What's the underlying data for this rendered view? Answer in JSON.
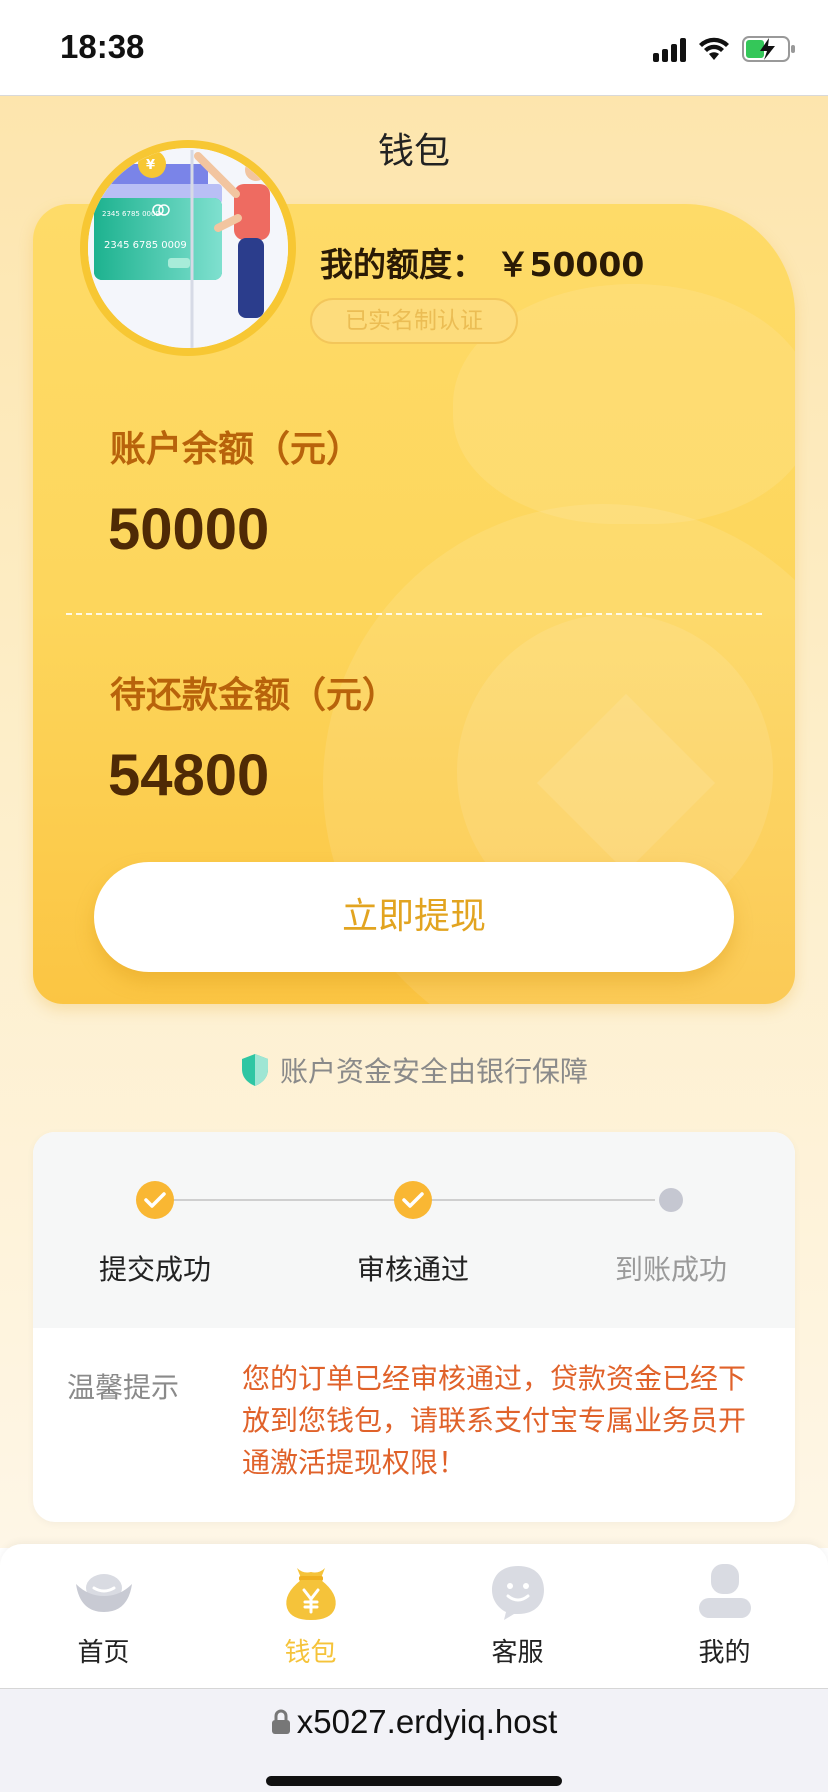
{
  "status_bar": {
    "time": "18:38"
  },
  "page": {
    "title": "钱包"
  },
  "wallet_card": {
    "credit_label": "我的额度：",
    "credit_value": "￥50000",
    "verified_badge": "已实名制认证",
    "balance_label": "账户余额（元）",
    "balance_value": "50000",
    "due_label": "待还款金额（元）",
    "due_value": "54800",
    "withdraw_button": "立即提现"
  },
  "safety_note": "账户资金安全由银行保障",
  "progress": {
    "steps": [
      {
        "label": "提交成功",
        "status": "done"
      },
      {
        "label": "审核通过",
        "status": "done"
      },
      {
        "label": "到账成功",
        "status": "pending"
      }
    ],
    "tip_label": "温馨提示",
    "tip_text": "您的订单已经审核通过，贷款资金已经下放到您钱包，请联系支付宝专属业务员开通激活提现权限！"
  },
  "tabbar": {
    "items": [
      {
        "label": "首页",
        "icon": "home-ingot-icon",
        "active": false
      },
      {
        "label": "钱包",
        "icon": "wallet-moneybag-icon",
        "active": true
      },
      {
        "label": "客服",
        "icon": "chat-bubble-icon",
        "active": false
      },
      {
        "label": "我的",
        "icon": "user-icon",
        "active": false
      }
    ]
  },
  "browser": {
    "url": "x5027.erdyiq.host"
  },
  "colors": {
    "accent": "#f5c33a",
    "card_gold": "#fdd65c",
    "label_brown": "#b8630b",
    "value_brown": "#4f2a05",
    "tip_orange": "#e0622a",
    "step_gold": "#f9b733"
  }
}
